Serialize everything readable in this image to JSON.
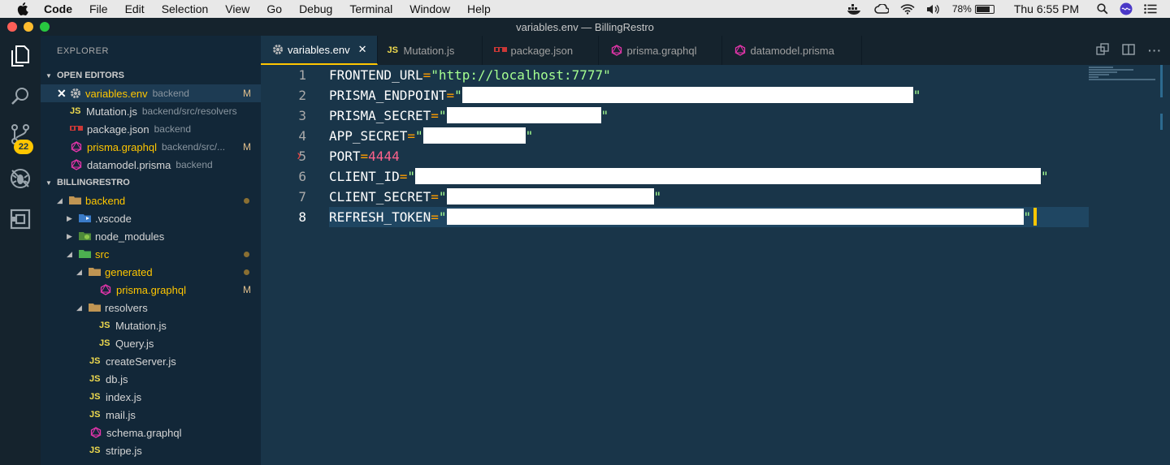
{
  "menubar": {
    "app": "Code",
    "items": [
      "File",
      "Edit",
      "Selection",
      "View",
      "Go",
      "Debug",
      "Terminal",
      "Window",
      "Help"
    ],
    "battery_percent": "78%",
    "battery_level": 0.78,
    "clock": "Thu 6:55 PM"
  },
  "window": {
    "title": "variables.env — BillingRestro"
  },
  "activity": {
    "scm_badge": "22"
  },
  "sidebar": {
    "title": "EXPLORER",
    "open_editors_label": "OPEN EDITORS",
    "open_editors": [
      {
        "name": "variables.env",
        "desc": "backend",
        "mod": "M",
        "icon": "gear-icon"
      },
      {
        "name": "Mutation.js",
        "desc": "backend/src/resolvers",
        "mod": "",
        "icon": "js-icon"
      },
      {
        "name": "package.json",
        "desc": "backend",
        "mod": "",
        "icon": "npm-icon"
      },
      {
        "name": "prisma.graphql",
        "desc": "backend/src/...",
        "mod": "M",
        "icon": "graphql-icon"
      },
      {
        "name": "datamodel.prisma",
        "desc": "backend",
        "mod": "",
        "icon": "prisma-icon"
      }
    ],
    "project_label": "BILLINGRESTRO",
    "tree": {
      "backend": "backend",
      "vscode": ".vscode",
      "node_modules": "node_modules",
      "src": "src",
      "generated": "generated",
      "prisma_graphql": "prisma.graphql",
      "prisma_mod": "M",
      "resolvers": "resolvers",
      "mutation": "Mutation.js",
      "query": "Query.js",
      "createServer": "createServer.js",
      "db": "db.js",
      "index": "index.js",
      "mail": "mail.js",
      "schema": "schema.graphql",
      "stripe": "stripe.js",
      "js": "JS"
    }
  },
  "tabs": [
    {
      "label": "variables.env",
      "icon": "gear-icon",
      "active": true
    },
    {
      "label": "Mutation.js",
      "icon": "js-icon",
      "active": false
    },
    {
      "label": "package.json",
      "icon": "npm-icon",
      "active": false
    },
    {
      "label": "prisma.graphql",
      "icon": "graphql-icon",
      "active": false
    },
    {
      "label": "datamodel.prisma",
      "icon": "prisma-icon",
      "active": false
    }
  ],
  "editor": {
    "line_numbers": [
      "1",
      "2",
      "3",
      "4",
      "5",
      "6",
      "7",
      "8"
    ],
    "lines": [
      {
        "key": "FRONTEND_URL",
        "value": "http://localhost:7777"
      },
      {
        "key": "PRISMA_ENDPOINT",
        "value": ""
      },
      {
        "key": "PRISMA_SECRET",
        "value": ""
      },
      {
        "key": "APP_SECRET",
        "value": ""
      },
      {
        "key": "PORT",
        "value": "4444"
      },
      {
        "key": "CLIENT_ID",
        "value": ""
      },
      {
        "key": "CLIENT_SECRET",
        "value": ""
      },
      {
        "key": "REFRESH_TOKEN",
        "value": ""
      }
    ],
    "eq": "=",
    "quote": "\""
  }
}
